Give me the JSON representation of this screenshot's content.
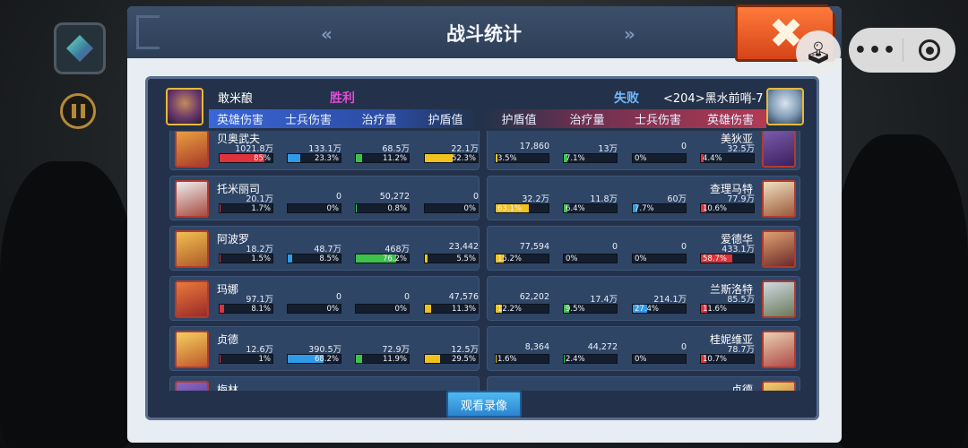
{
  "title": "战斗统计",
  "nav": {
    "prev": "«",
    "next": "»"
  },
  "capsule": {
    "more": "•••"
  },
  "left_team": {
    "name": "敢米酿",
    "result": "胜利"
  },
  "right_team": {
    "name": "<204>黑水前哨-7",
    "result": "失败"
  },
  "columns_left": [
    "英雄伤害",
    "士兵伤害",
    "治疗量",
    "护盾值"
  ],
  "columns_right": [
    "护盾值",
    "治疗量",
    "士兵伤害",
    "英雄伤害"
  ],
  "colors": {
    "hero_damage": "#e0323a",
    "soldier_damage": "#2f9be8",
    "heal": "#3ec24a",
    "shield": "#f0c21e",
    "win": "#e24bd6",
    "lose": "#6fb8ff"
  },
  "rows": [
    {
      "left": {
        "name": "贝奥武夫",
        "stats": [
          {
            "v": "1021.8万",
            "p": "85%",
            "f": 0.85
          },
          {
            "v": "133.1万",
            "p": "23.3%",
            "f": 0.233
          },
          {
            "v": "68.5万",
            "p": "11.2%",
            "f": 0.112
          },
          {
            "v": "22.1万",
            "p": "52.3%",
            "f": 0.523
          }
        ]
      },
      "right": {
        "name": "美狄亚",
        "stats": [
          {
            "v": "17,860",
            "p": "3.5%",
            "f": 0.035
          },
          {
            "v": "13万",
            "p": "7.1%",
            "f": 0.071
          },
          {
            "v": "0",
            "p": "0%",
            "f": 0
          },
          {
            "v": "32.5万",
            "p": "4.4%",
            "f": 0.044
          }
        ]
      }
    },
    {
      "left": {
        "name": "托米丽司",
        "stats": [
          {
            "v": "20.1万",
            "p": "1.7%",
            "f": 0.017
          },
          {
            "v": "0",
            "p": "0%",
            "f": 0
          },
          {
            "v": "50,272",
            "p": "0.8%",
            "f": 0.008
          },
          {
            "v": "0",
            "p": "0%",
            "f": 0
          }
        ]
      },
      "right": {
        "name": "查理马特",
        "stats": [
          {
            "v": "32.2万",
            "p": "63.1%",
            "f": 0.631
          },
          {
            "v": "11.8万",
            "p": "6.4%",
            "f": 0.064
          },
          {
            "v": "60万",
            "p": "7.7%",
            "f": 0.077
          },
          {
            "v": "77.9万",
            "p": "10.6%",
            "f": 0.106
          }
        ]
      }
    },
    {
      "left": {
        "name": "阿波罗",
        "stats": [
          {
            "v": "18.2万",
            "p": "1.5%",
            "f": 0.015
          },
          {
            "v": "48.7万",
            "p": "8.5%",
            "f": 0.085
          },
          {
            "v": "468万",
            "p": "76.2%",
            "f": 0.762
          },
          {
            "v": "23,442",
            "p": "5.5%",
            "f": 0.055
          }
        ]
      },
      "right": {
        "name": "爱德华",
        "stats": [
          {
            "v": "77,594",
            "p": "15.2%",
            "f": 0.152
          },
          {
            "v": "0",
            "p": "0%",
            "f": 0
          },
          {
            "v": "0",
            "p": "0%",
            "f": 0
          },
          {
            "v": "433.1万",
            "p": "58.7%",
            "f": 0.587
          }
        ]
      }
    },
    {
      "left": {
        "name": "玛娜",
        "stats": [
          {
            "v": "97.1万",
            "p": "8.1%",
            "f": 0.081
          },
          {
            "v": "0",
            "p": "0%",
            "f": 0
          },
          {
            "v": "0",
            "p": "0%",
            "f": 0
          },
          {
            "v": "47,576",
            "p": "11.3%",
            "f": 0.113
          }
        ]
      },
      "right": {
        "name": "兰斯洛特",
        "stats": [
          {
            "v": "62,202",
            "p": "12.2%",
            "f": 0.122
          },
          {
            "v": "17.4万",
            "p": "9.5%",
            "f": 0.095
          },
          {
            "v": "214.1万",
            "p": "27.4%",
            "f": 0.274
          },
          {
            "v": "85.5万",
            "p": "11.6%",
            "f": 0.116
          }
        ]
      }
    },
    {
      "left": {
        "name": "贞德",
        "stats": [
          {
            "v": "12.6万",
            "p": "1%",
            "f": 0.01
          },
          {
            "v": "390.5万",
            "p": "68.2%",
            "f": 0.682
          },
          {
            "v": "72.9万",
            "p": "11.9%",
            "f": 0.119
          },
          {
            "v": "12.5万",
            "p": "29.5%",
            "f": 0.295
          }
        ]
      },
      "right": {
        "name": "桂妮维亚",
        "stats": [
          {
            "v": "8,364",
            "p": "1.6%",
            "f": 0.016
          },
          {
            "v": "44,272",
            "p": "2.4%",
            "f": 0.024
          },
          {
            "v": "0",
            "p": "0%",
            "f": 0
          },
          {
            "v": "78.7万",
            "p": "10.7%",
            "f": 0.107
          }
        ]
      }
    },
    {
      "left": {
        "name": "梅林",
        "stats": []
      },
      "right": {
        "name": "贞德",
        "stats": []
      }
    }
  ],
  "replay_button": "观看录像"
}
